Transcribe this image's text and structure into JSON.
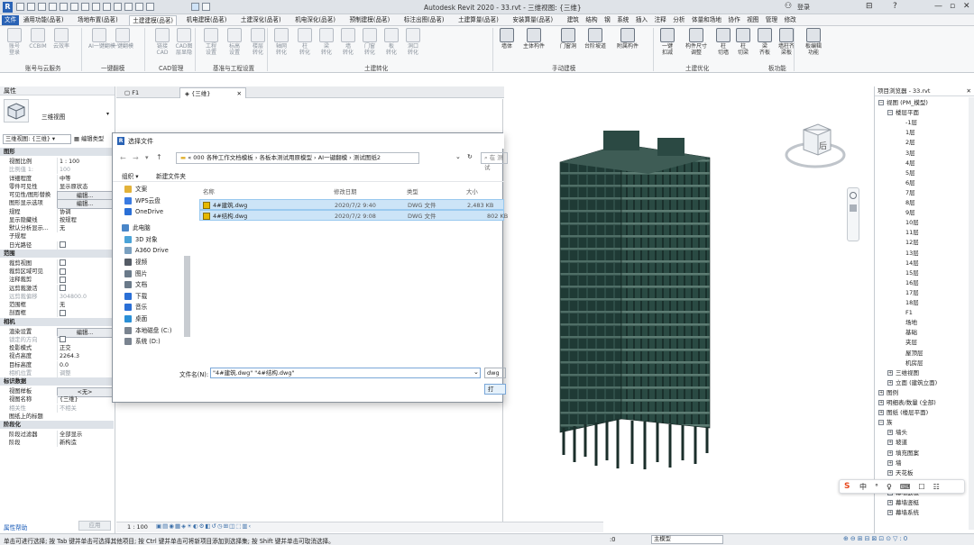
{
  "app": {
    "title": "Autodesk Revit 2020 - 33.rvt - 三维视图: {三维}",
    "sign_in": "登录",
    "help": "?"
  },
  "menu": {
    "tabs": [
      "文件",
      "通用功能(品茗)",
      "场地布置(品茗)",
      "土建建模(品茗)",
      "机电建模(品茗)",
      "土建深化(品茗)",
      "机电深化(品茗)",
      "预制建模(品茗)",
      "标注出图(品茗)",
      "土建算量(品茗)",
      "安装算量(品茗)",
      "建筑",
      "结构",
      "钢",
      "系统",
      "插入",
      "注释",
      "分析",
      "体量和场地",
      "协作",
      "视图",
      "管理",
      "修改"
    ]
  },
  "ribbon": {
    "buttons": [
      {
        "label": "账号\n登录"
      },
      {
        "label": "CCBIM"
      },
      {
        "label": "云效率"
      },
      {
        "label": "AI一键翻模"
      },
      {
        "label": "一键翻模"
      },
      {
        "label": "链接\nCAD"
      },
      {
        "label": "CAD图\n层显隐"
      },
      {
        "label": "工程\n设置"
      },
      {
        "label": "标高\n设置"
      },
      {
        "label": "楼层\n转化"
      },
      {
        "label": "轴网\n转化"
      },
      {
        "label": "柱\n转化"
      },
      {
        "label": "梁\n转化"
      },
      {
        "label": "墙\n转化"
      },
      {
        "label": "门窗\n转化"
      },
      {
        "label": "板\n转化"
      },
      {
        "label": "洞口\n转化"
      },
      {
        "label": "墙体"
      },
      {
        "label": "主体构件"
      },
      {
        "label": "门窗洞"
      },
      {
        "label": "台阶坡道"
      },
      {
        "label": "附属构件"
      },
      {
        "label": "一键\n扣减"
      },
      {
        "label": "构件尺寸\n调整"
      },
      {
        "label": "柱\n切墙"
      },
      {
        "label": "柱\n切梁"
      },
      {
        "label": "梁\n齐板"
      },
      {
        "label": "墙柱齐\n梁板"
      },
      {
        "label": "板编辑\n功能"
      }
    ],
    "groups": [
      "账号与云服务",
      "一键翻模",
      "CAD管理",
      "基准与工程设置",
      "土建转化",
      "手动建模",
      "土建优化",
      "板功能"
    ]
  },
  "properties": {
    "header": "属性",
    "type_name": "三维视图",
    "selector": "三维视图: {三维}",
    "edit_type": "编辑类型",
    "rows": [
      {
        "cat": "图形"
      },
      {
        "k": "视图比例",
        "v": "1 : 100"
      },
      {
        "k": "比例值 1:",
        "v": "100",
        "grey": true
      },
      {
        "k": "详细程度",
        "v": "中等"
      },
      {
        "k": "零件可见性",
        "v": "显示原状态"
      },
      {
        "k": "可见性/图形替换",
        "v": "编辑...",
        "btn": true
      },
      {
        "k": "图形显示选项",
        "v": "编辑...",
        "btn": true
      },
      {
        "k": "规程",
        "v": "协调"
      },
      {
        "k": "显示隐藏线",
        "v": "按规程"
      },
      {
        "k": "默认分析显示...",
        "v": "无"
      },
      {
        "k": "子规程",
        "v": ""
      },
      {
        "k": "日光路径",
        "v": "cb"
      },
      {
        "cat": "范围"
      },
      {
        "k": "裁剪视图",
        "v": "cb"
      },
      {
        "k": "裁剪区域可见",
        "v": "cb"
      },
      {
        "k": "注释裁剪",
        "v": "cb"
      },
      {
        "k": "远剪裁激活",
        "v": "cb"
      },
      {
        "k": "远剪裁偏移",
        "v": "304800.0",
        "grey": true
      },
      {
        "k": "范围框",
        "v": "无"
      },
      {
        "k": "剖面框",
        "v": "cb"
      },
      {
        "cat": "相机"
      },
      {
        "k": "渲染设置",
        "v": "编辑...",
        "btn": true
      },
      {
        "k": "锁定的方向",
        "v": "cb",
        "grey": true
      },
      {
        "k": "投影模式",
        "v": "正交"
      },
      {
        "k": "视点高度",
        "v": "2264.3"
      },
      {
        "k": "目标高度",
        "v": "0.0"
      },
      {
        "k": "相机位置",
        "v": "调整",
        "grey": true
      },
      {
        "cat": "标识数据"
      },
      {
        "k": "视图样板",
        "v": "<无>",
        "btn": true
      },
      {
        "k": "视图名称",
        "v": "{三维}"
      },
      {
        "k": "相关性",
        "v": "不相关",
        "grey": true
      },
      {
        "k": "图纸上的标题",
        "v": ""
      },
      {
        "cat": "阶段化"
      },
      {
        "k": "阶段过滤器",
        "v": "全部显示"
      },
      {
        "k": "阶段",
        "v": "新构造"
      }
    ],
    "help_link": "属性帮助",
    "apply": "应用"
  },
  "view_tabs": [
    {
      "label": "F1"
    },
    {
      "label": "{三维}"
    }
  ],
  "dialog": {
    "title": "选择文件",
    "path": [
      "000 各种工作文档模板",
      "各板本测试用原模型",
      "AI一键翻模",
      "测试图纸2"
    ],
    "search_placeholder": "在 测试",
    "organize": "组织 ▾",
    "new_folder": "新建文件夹",
    "nav": [
      {
        "label": "文案",
        "color": "#e2b23a"
      },
      {
        "label": "WPS云盘",
        "color": "#3a7be2"
      },
      {
        "label": "OneDrive",
        "color": "#2a6fd6"
      },
      {
        "label": "此电脑",
        "color": "#4a86c8"
      },
      {
        "label": "3D 对象",
        "color": "#4aa3d8"
      },
      {
        "label": "A360 Drive",
        "color": "#7aa0c0"
      },
      {
        "label": "视频",
        "color": "#555c66"
      },
      {
        "label": "图片",
        "color": "#6a7a8a"
      },
      {
        "label": "文档",
        "color": "#6a7a8a"
      },
      {
        "label": "下载",
        "color": "#2a6fd6"
      },
      {
        "label": "音乐",
        "color": "#2a6fd6"
      },
      {
        "label": "桌面",
        "color": "#2a8fd6"
      },
      {
        "label": "本地磁盘 (C:)",
        "color": "#7a8490"
      },
      {
        "label": "系统 (D:)",
        "color": "#7a8490"
      }
    ],
    "columns": [
      "名称",
      "修改日期",
      "类型",
      "大小"
    ],
    "files": [
      {
        "name": "4#建筑.dwg",
        "date": "2020/7/2 9:40",
        "type": "DWG 文件",
        "size": "2,483 KB"
      },
      {
        "name": "4#结构.dwg",
        "date": "2020/7/2 9:08",
        "type": "DWG 文件",
        "size": "802 KB"
      }
    ],
    "filename_label": "文件名(N):",
    "filename_value": "\"4#建筑.dwg\" \"4#结构.dwg\"",
    "filetype": "dwg文",
    "open": "打"
  },
  "project_browser": {
    "header": "项目浏览器 - 33.rvt",
    "items": [
      {
        "label": "视图 (PM_模型)",
        "lvl": 0,
        "exp": "−"
      },
      {
        "label": "楼层平面",
        "lvl": 1,
        "exp": "−"
      },
      {
        "label": "-1层",
        "lvl": 2
      },
      {
        "label": "1层",
        "lvl": 2
      },
      {
        "label": "2层",
        "lvl": 2
      },
      {
        "label": "3层",
        "lvl": 2
      },
      {
        "label": "4层",
        "lvl": 2
      },
      {
        "label": "5层",
        "lvl": 2
      },
      {
        "label": "6层",
        "lvl": 2
      },
      {
        "label": "7层",
        "lvl": 2
      },
      {
        "label": "8层",
        "lvl": 2
      },
      {
        "label": "9层",
        "lvl": 2
      },
      {
        "label": "10层",
        "lvl": 2
      },
      {
        "label": "11层",
        "lvl": 2
      },
      {
        "label": "12层",
        "lvl": 2
      },
      {
        "label": "13层",
        "lvl": 2
      },
      {
        "label": "14层",
        "lvl": 2
      },
      {
        "label": "15层",
        "lvl": 2
      },
      {
        "label": "16层",
        "lvl": 2
      },
      {
        "label": "17层",
        "lvl": 2
      },
      {
        "label": "18层",
        "lvl": 2
      },
      {
        "label": "F1",
        "lvl": 2
      },
      {
        "label": "场地",
        "lvl": 2
      },
      {
        "label": "基础",
        "lvl": 2
      },
      {
        "label": "夹层",
        "lvl": 2
      },
      {
        "label": "屋顶层",
        "lvl": 2
      },
      {
        "label": "机房层",
        "lvl": 2
      },
      {
        "label": "三维视图",
        "lvl": 1,
        "exp": "+"
      },
      {
        "label": "立面 (建筑立面)",
        "lvl": 1,
        "exp": "+"
      },
      {
        "label": "图例",
        "lvl": 0,
        "exp": "+"
      },
      {
        "label": "明细表/数量 (全部)",
        "lvl": 0,
        "exp": "+"
      },
      {
        "label": "图纸 (楼层平面)",
        "lvl": 0,
        "exp": "+"
      },
      {
        "label": "族",
        "lvl": 0,
        "exp": "−"
      },
      {
        "label": "墙头",
        "lvl": 1,
        "exp": "+"
      },
      {
        "label": "坡道",
        "lvl": 1,
        "exp": "+"
      },
      {
        "label": "填充图案",
        "lvl": 1,
        "exp": "+"
      },
      {
        "label": "墙",
        "lvl": 1,
        "exp": "+"
      },
      {
        "label": "天花板",
        "lvl": 1,
        "exp": "+"
      },
      {
        "label": "常规模型",
        "lvl": 1,
        "exp": "+"
      },
      {
        "label": "幕墙嵌板",
        "lvl": 1,
        "exp": "+"
      },
      {
        "label": "幕墙竖梃",
        "lvl": 1,
        "exp": "+"
      },
      {
        "label": "幕墙系统",
        "lvl": 1,
        "exp": "+"
      }
    ]
  },
  "viewcube": {
    "face": "后"
  },
  "view_bar": {
    "scale": "1 : 100"
  },
  "status": {
    "text": "单击可进行选择; 按 Tab 键并单击可选择其他项目; 按 Ctrl 键并单击可将新项目添加到选择集; 按 Shift 键并单击可取消选择。",
    "model": "主模型",
    "zero": ":0"
  },
  "ime": {
    "items": [
      "中",
      "°",
      "♀",
      "⌨",
      "☐",
      "☷"
    ]
  }
}
